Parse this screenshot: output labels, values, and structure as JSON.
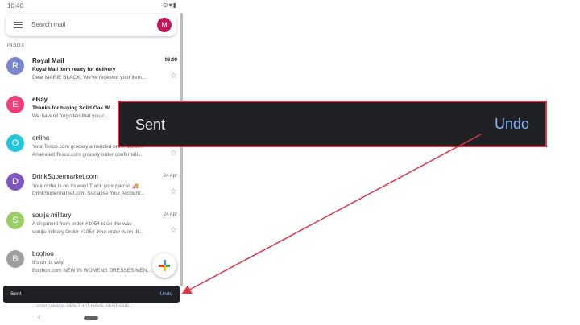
{
  "status_bar": {
    "time": "10:40",
    "icons": "⊙▾▮"
  },
  "search": {
    "placeholder": "Search mail",
    "avatar_letter": "M",
    "avatar_color": "#c2185b"
  },
  "section_label": "INBOX",
  "emails": [
    {
      "avatar": "R",
      "color": "#7986cb",
      "sender": "Royal Mail",
      "date": "06:00",
      "subject": "Royal Mail item  ready for delivery",
      "snippet": "Dear MARIE BLACK, We've received your item...",
      "unread": true
    },
    {
      "avatar": "E",
      "color": "#ec407a",
      "sender": "eBay",
      "date": "",
      "subject": "Thanks for buying Solid Oak W...",
      "snippet": "We haven't forgotten that you c...",
      "unread": true
    },
    {
      "avatar": "O",
      "color": "#26c6da",
      "sender": "online",
      "date": "",
      "subject": "Your Tesco.com grocery amended order confir...",
      "snippet": "Amended Tesco.com grocery order confirmati...",
      "unread": false
    },
    {
      "avatar": "D",
      "color": "#7e57c2",
      "sender": "DrinkSupermarket.com",
      "date": "24 Apr",
      "subject": "Your order is on its way! Track your parcel. 🚚",
      "snippet": "DrinkSupermarket.com Socialise Your Account...",
      "unread": false
    },
    {
      "avatar": "S",
      "color": "#9ccc65",
      "sender": "soulja military",
      "date": "24 Apr",
      "subject": "A shipment from order #1054 is on the way",
      "snippet": "soulja military Order #1054 Your order is on th...",
      "unread": false
    },
    {
      "avatar": "B",
      "color": "#9e9e9e",
      "sender": "boohoo",
      "date": "",
      "subject": "It's on its way",
      "snippet": "Boohoo.com NEW IN WOMENS DRESSES MEN...",
      "unread": false
    }
  ],
  "peek_text": "...order update. SEN THAT HAVE SENT EDE...",
  "snackbar": {
    "message": "Sent",
    "action": "Undo"
  },
  "callout": {
    "message": "Sent",
    "action": "Undo"
  },
  "colors": {
    "snackbar_bg": "#202124",
    "action": "#8ab4f8",
    "highlight": "#e0364a"
  }
}
